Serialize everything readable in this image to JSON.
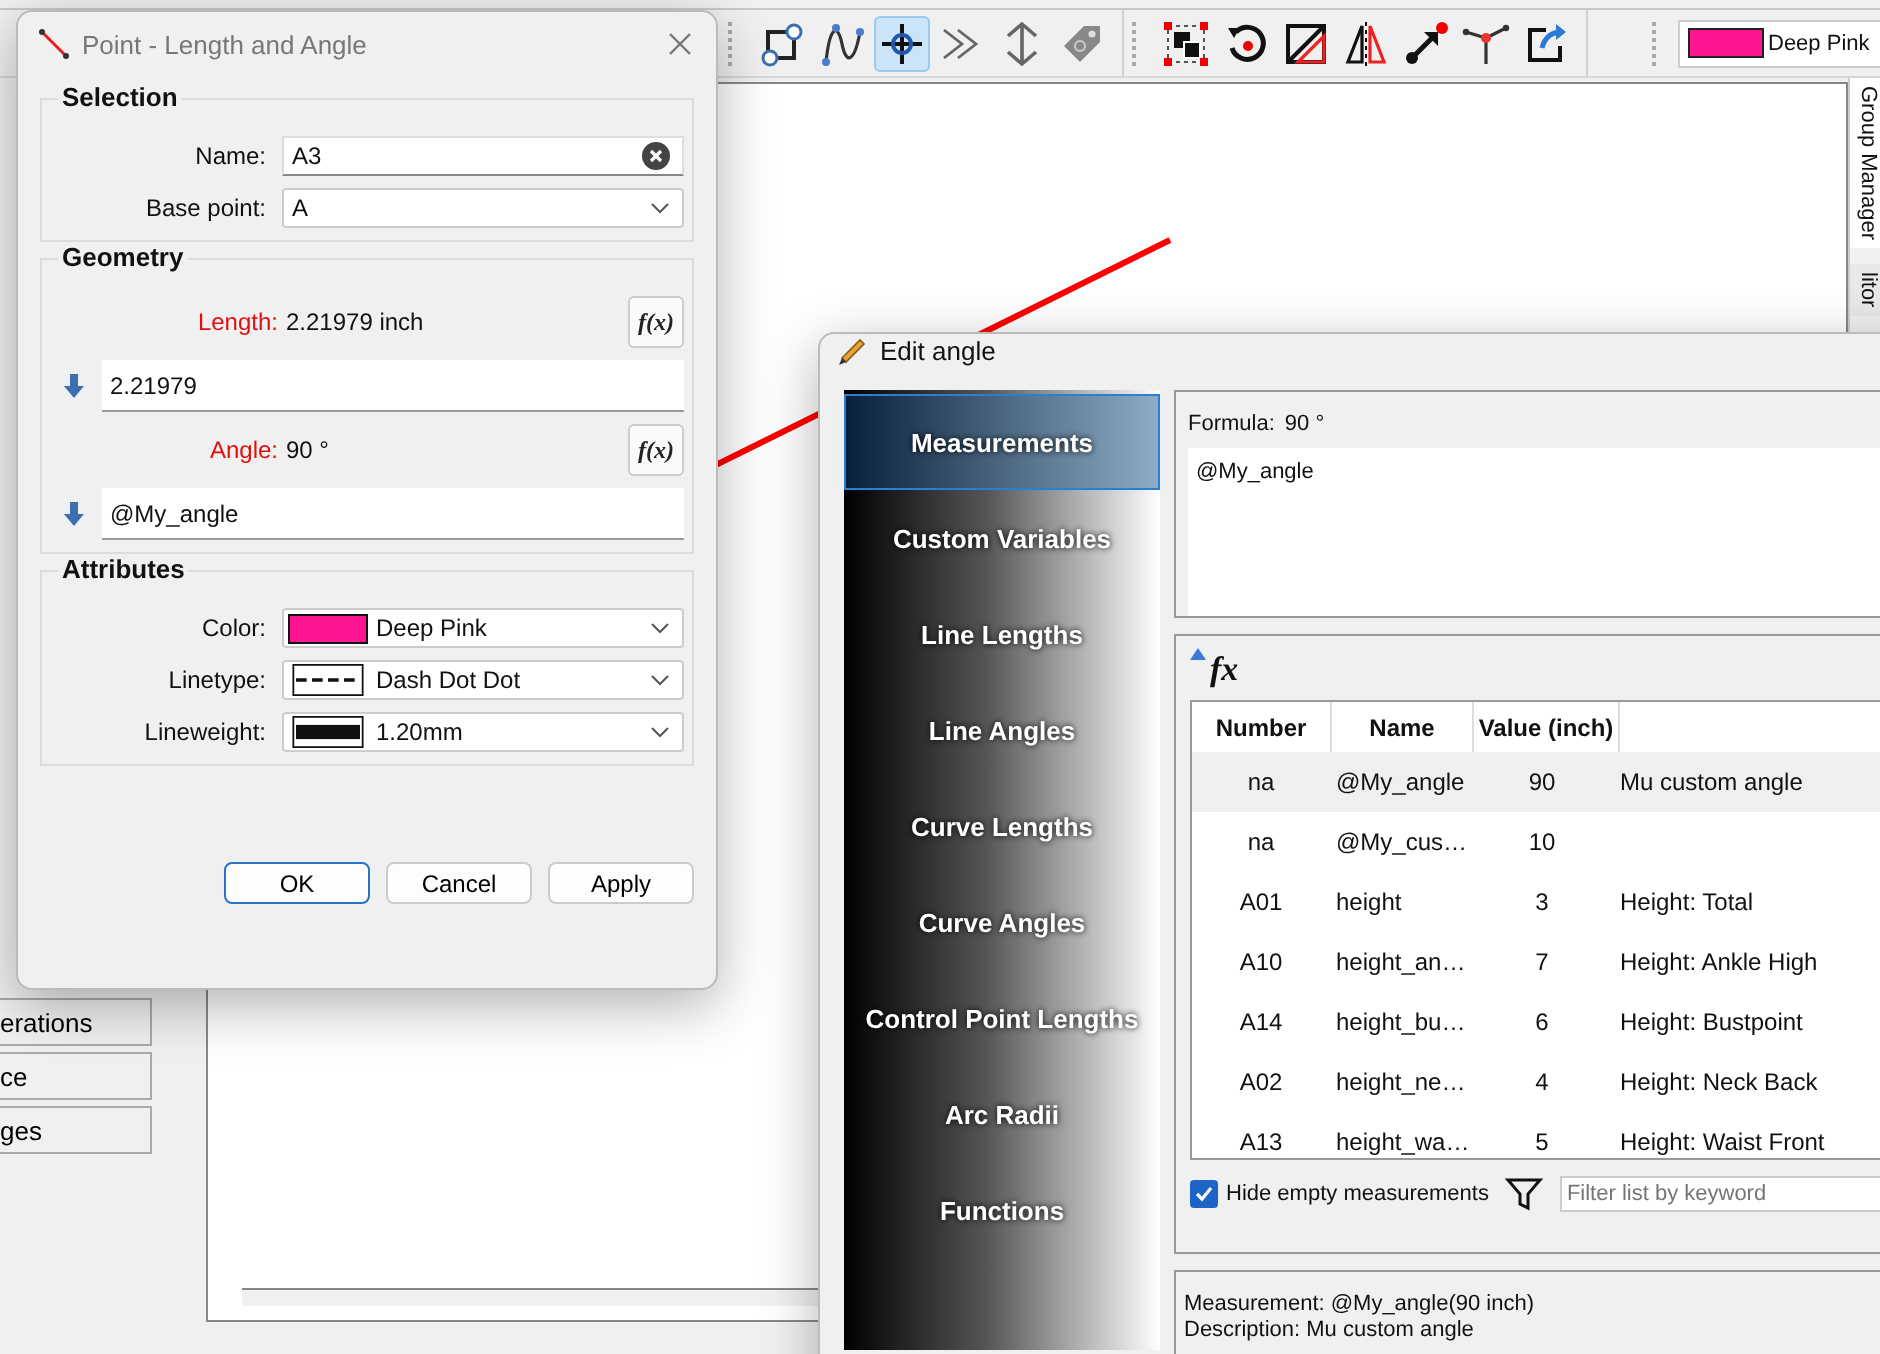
{
  "main_window": {
    "toolbar": {
      "tools": [
        {
          "selected": false
        },
        {
          "selected": false
        },
        {
          "selected": true
        },
        {
          "selected": false
        },
        {
          "selected": false
        },
        {
          "selected": false
        },
        {
          "selected": false
        },
        {
          "selected": false
        },
        {
          "selected": false
        },
        {
          "selected": false
        },
        {
          "selected": false
        },
        {
          "selected": false
        },
        {
          "selected": false
        }
      ],
      "color_field": {
        "value": "Deep Pink",
        "color": "#ff1493"
      }
    },
    "left_panel": {
      "items": [
        {
          "label": "erations"
        },
        {
          "label": "ce"
        },
        {
          "label": "ges"
        }
      ]
    },
    "dock_tabs": [
      {
        "label": "Group Manager",
        "selected": true
      },
      {
        "label": "litor",
        "selected": false
      }
    ]
  },
  "point_dialog": {
    "title": "Point - Length and Angle",
    "selection": {
      "heading": "Selection",
      "name": {
        "label": "Name:",
        "value": "A3"
      },
      "base_point": {
        "label": "Base point:",
        "value": "A"
      }
    },
    "geometry": {
      "heading": "Geometry",
      "length": {
        "label": "Length:",
        "reading": "2.21979 inch",
        "button": "f(x)",
        "formula": "2.21979"
      },
      "angle": {
        "label": "Angle:",
        "reading": "90 °",
        "button": "f(x)",
        "formula": "@My_angle"
      }
    },
    "attributes": {
      "heading": "Attributes",
      "color": {
        "label": "Color:",
        "value": "Deep Pink",
        "color": "#ff1493"
      },
      "linetype": {
        "label": "Linetype:",
        "value": "Dash Dot Dot"
      },
      "lineweight": {
        "label": "Lineweight:",
        "value": "1.20mm"
      }
    },
    "buttons": [
      {
        "label": "OK",
        "default": true
      },
      {
        "label": "Cancel",
        "default": false
      },
      {
        "label": "Apply",
        "default": false
      }
    ]
  },
  "edit_angle_dialog": {
    "title": "Edit angle",
    "nav": [
      {
        "label": "Measurements",
        "selected": true
      },
      {
        "label": "Custom Variables",
        "selected": false
      },
      {
        "label": "Line Lengths",
        "selected": false
      },
      {
        "label": "Line Angles",
        "selected": false
      },
      {
        "label": "Curve Lengths",
        "selected": false
      },
      {
        "label": "Curve Angles",
        "selected": false
      },
      {
        "label": "Control Point Lengths",
        "selected": false
      },
      {
        "label": "Arc Radii",
        "selected": false
      },
      {
        "label": "Functions",
        "selected": false
      }
    ],
    "formula": {
      "label": "Formula:",
      "reading": "90 °",
      "value": "@My_angle"
    },
    "function_button": "fx",
    "table": {
      "columns": [
        "Number",
        "Name",
        "Value (inch)"
      ],
      "rows": [
        {
          "cells": [
            "na",
            "@My_angle",
            "90",
            "Mu custom angle"
          ],
          "selected": true
        },
        {
          "cells": [
            "na",
            "@My_cus…",
            "10",
            ""
          ],
          "selected": false
        },
        {
          "cells": [
            "A01",
            "height",
            "3",
            "Height: Total"
          ],
          "selected": false
        },
        {
          "cells": [
            "A10",
            "height_an…",
            "7",
            "Height: Ankle High"
          ],
          "selected": false
        },
        {
          "cells": [
            "A14",
            "height_bu…",
            "6",
            "Height: Bustpoint"
          ],
          "selected": false
        },
        {
          "cells": [
            "A02",
            "height_ne…",
            "4",
            "Height: Neck Back"
          ],
          "selected": false
        },
        {
          "cells": [
            "A13",
            "height_wa…",
            "5",
            "Height: Waist Front"
          ],
          "selected": false
        }
      ]
    },
    "hide_empty": {
      "label": "Hide empty measurements",
      "checked": true
    },
    "filter": {
      "placeholder": "Filter list by keyword"
    },
    "info": [
      "Measurement: @My_angle(90 inch)",
      "Description: Mu custom angle"
    ]
  }
}
